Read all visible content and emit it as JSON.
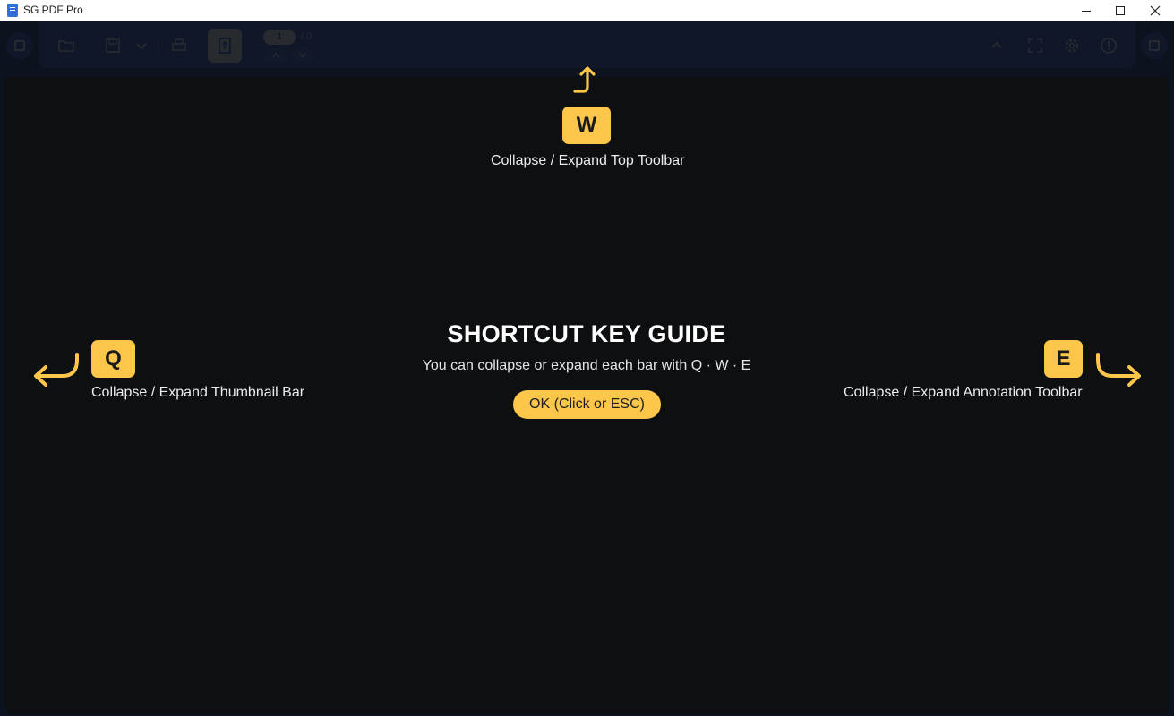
{
  "window": {
    "title": "SG PDF Pro",
    "controls": {
      "minimize": "minimize-icon",
      "maximize": "maximize-icon",
      "close": "close-icon"
    }
  },
  "toolbar": {
    "page_current": "1",
    "page_total": "/ 0",
    "icons": [
      "collapse-left-icon",
      "folder-open-icon",
      "save-icon",
      "chevron-down-icon",
      "print-icon",
      "page-mode-icon",
      "page-up-icon",
      "page-down-icon",
      "chevron-up-icon",
      "fullscreen-icon",
      "gear-icon",
      "info-icon",
      "collapse-right-icon"
    ]
  },
  "guide": {
    "title": "SHORTCUT KEY GUIDE",
    "subtitle": "You can collapse or expand each bar with Q · W · E",
    "ok_label": "OK (Click or ESC)",
    "keys": {
      "w": {
        "key": "W",
        "label": "Collapse / Expand Top Toolbar"
      },
      "q": {
        "key": "Q",
        "label": "Collapse / Expand Thumbnail Bar"
      },
      "e": {
        "key": "E",
        "label": "Collapse / Expand Annotation Toolbar"
      }
    }
  },
  "colors": {
    "accent": "#fbc64a",
    "toolbar": "#2b58c2",
    "overlay": "#0d0f12",
    "text": "#ececec"
  }
}
